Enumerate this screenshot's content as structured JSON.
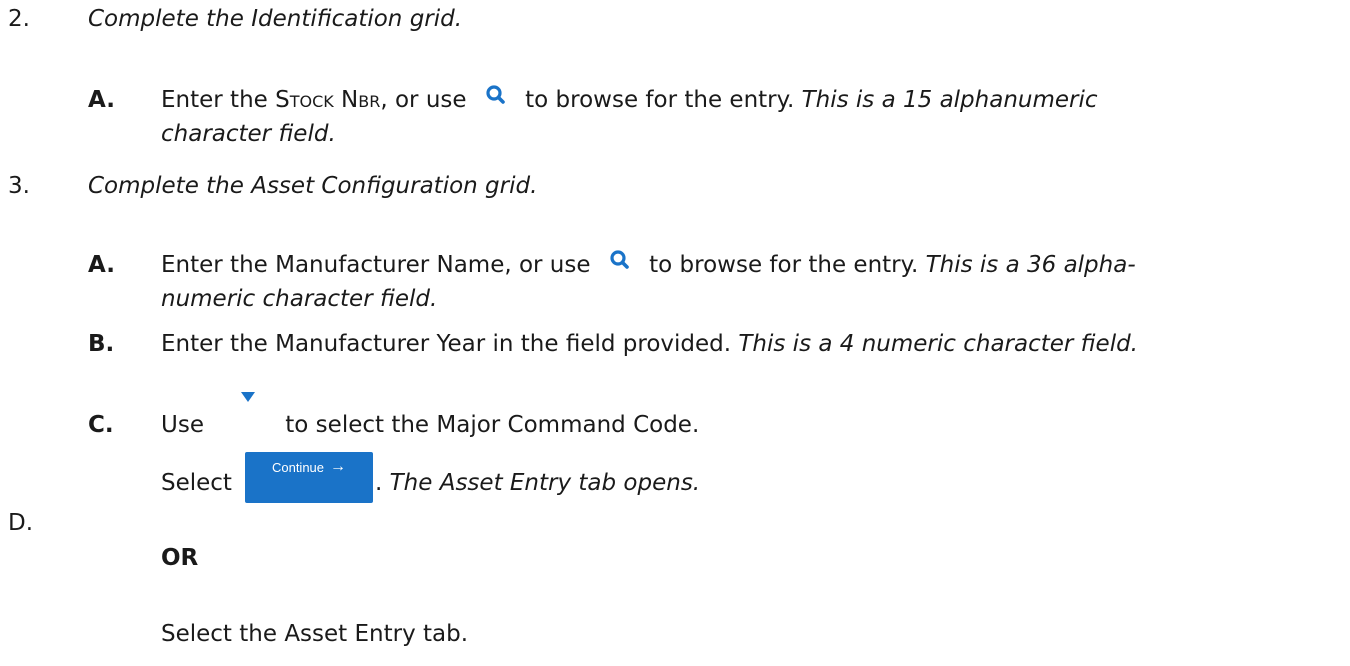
{
  "steps": [
    {
      "number": "2.",
      "title": "Complete the Identification grid.",
      "substeps": [
        {
          "letter": "A.",
          "text_before": "Enter the ",
          "field_name": "Stock Nbr",
          "text_mid": ", or use ",
          "icon": "search-icon",
          "text_after": " to browse for the entry. ",
          "note_line1": "This is a 15 alphanumeric",
          "note_line2": "character field."
        }
      ]
    },
    {
      "number": "3.",
      "title": "Complete the Asset Configuration grid.",
      "substeps": [
        {
          "letter": "A.",
          "text_before": "Enter the Manufacturer Name, or use ",
          "icon": "search-icon",
          "text_after": " to browse for the entry. ",
          "note_line1": "This is a 36 alpha-",
          "note_line2": "numeric character field."
        },
        {
          "letter": "B.",
          "text": "Enter the Manufacturer Year in the field provided. ",
          "note": "This is a 4 numeric character field."
        },
        {
          "letter": "C.",
          "text_before": "Use ",
          "icon": "dropdown-triangle-icon",
          "text_after": "to select the Major Command Code."
        },
        {
          "letter": "D.",
          "select_label": "Select ",
          "button_label": "Continue",
          "button_arrow": "→",
          "after_button": ". ",
          "result_note": "The Asset Entry tab opens.",
          "or_label": "OR",
          "alternative": "Select the Asset Entry tab."
        }
      ]
    }
  ],
  "colors": {
    "icon_blue": "#1a73c8",
    "button_blue": "#1a73c8"
  }
}
